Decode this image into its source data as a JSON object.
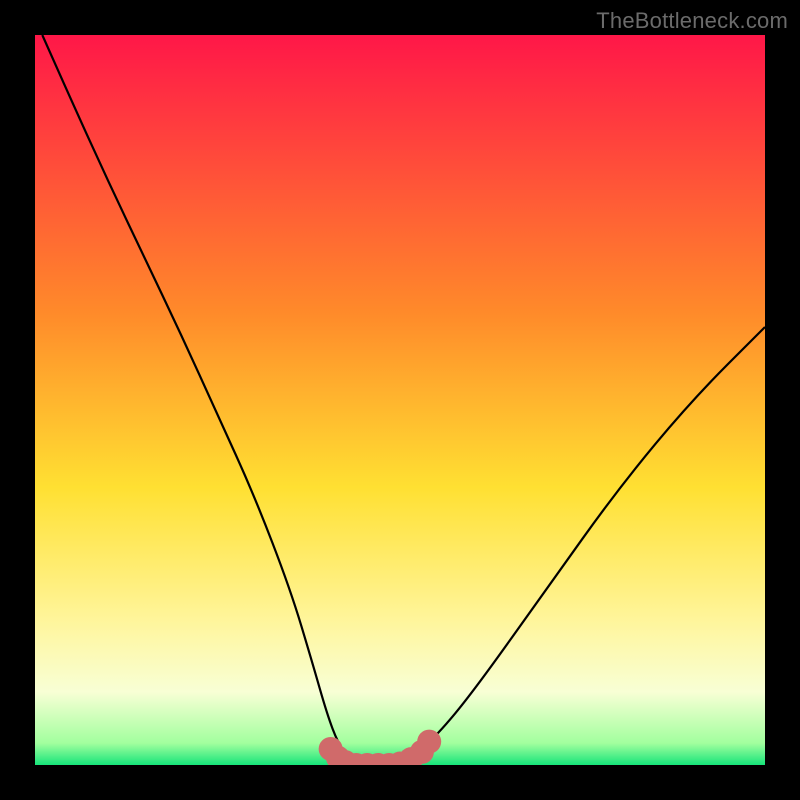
{
  "watermark": "TheBottleneck.com",
  "chart_data": {
    "type": "line",
    "title": "",
    "xlabel": "",
    "ylabel": "",
    "xlim": [
      0,
      100
    ],
    "ylim": [
      0,
      100
    ],
    "grid": false,
    "legend": false,
    "gradient_stops": [
      {
        "offset": 0,
        "color": "#ff1748"
      },
      {
        "offset": 38,
        "color": "#ff8a2a"
      },
      {
        "offset": 62,
        "color": "#ffe032"
      },
      {
        "offset": 80,
        "color": "#fff59a"
      },
      {
        "offset": 90,
        "color": "#f8ffd5"
      },
      {
        "offset": 97,
        "color": "#a2ff9e"
      },
      {
        "offset": 100,
        "color": "#16e47a"
      }
    ],
    "series": [
      {
        "name": "bottleneck-curve",
        "color": "#000000",
        "stroke_width": 2.2,
        "x": [
          1,
          5,
          10,
          15,
          20,
          25,
          30,
          35,
          38,
          40,
          41.5,
          43,
          45,
          46,
          48,
          50,
          52,
          55,
          60,
          70,
          80,
          90,
          100
        ],
        "y": [
          100,
          91,
          80,
          69.5,
          59,
          48,
          37,
          24,
          14,
          7,
          3,
          1,
          0,
          0,
          0,
          0.5,
          1.5,
          4,
          10,
          24,
          38,
          50,
          60
        ]
      },
      {
        "name": "bottom-markers",
        "type": "scatter",
        "color": "#d06a6a",
        "marker_radius": 12,
        "x": [
          40.5,
          41.5,
          42.5,
          44,
          45.5,
          47,
          48.5,
          50,
          51.5,
          53,
          54
        ],
        "y": [
          2.2,
          1.0,
          0.4,
          0,
          0,
          0,
          0,
          0.2,
          0.8,
          1.8,
          3.2
        ]
      }
    ],
    "annotations": []
  }
}
